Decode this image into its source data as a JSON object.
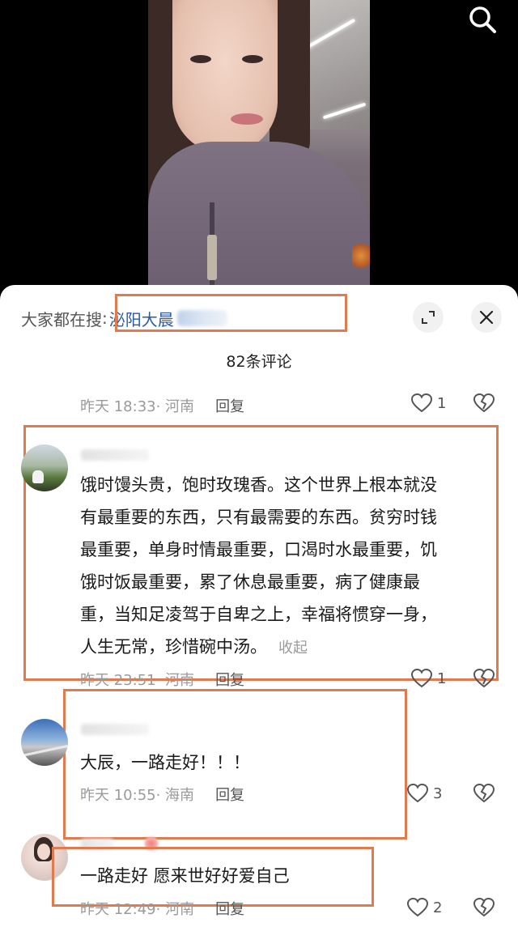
{
  "video": {
    "has_search": true
  },
  "header": {
    "trending_label": "大家都在搜",
    "trending_colon": ":",
    "trending_term": "泌阳大晨",
    "comment_count_title": "82条评论"
  },
  "comments": [
    {
      "time": "昨天 18:33",
      "location": "· 河南",
      "reply_label": "回复",
      "likes": "1"
    },
    {
      "lines": [
        "饿时馒头贵，饱时玫瑰香。这个世界上根本就没",
        "有最重要的东西，只有最需要的东西。贫穷时钱",
        "最重要，单身时情最重要，口渴时水最重要，饥",
        "饿时饭最重要，累了休息最重要，病了健康最",
        "重，当知足凌驾于自卑之上，幸福将惯穿一身，",
        "人生无常，珍惜碗中汤。"
      ],
      "collapse_label": "收起",
      "time": "昨天 23:51",
      "location": "· 河南",
      "reply_label": "回复",
      "likes": "1"
    },
    {
      "text": "大辰，一路走好！！！",
      "time": "昨天 10:55",
      "location": "· 海南",
      "reply_label": "回复",
      "likes": "3"
    },
    {
      "text": "一路走好 愿来世好好爱自己",
      "time": "昨天 12:49",
      "location": "· 河南",
      "reply_label": "回复",
      "likes": "2"
    }
  ],
  "colors": {
    "highlight_box": "#e07b4f",
    "trending_term": "#2a5aa6",
    "meta_gray": "#9a9a9a"
  },
  "icons": {
    "search": "search-icon",
    "expand": "expand-icon",
    "close": "close-icon",
    "like": "heart-icon",
    "dislike": "broken-heart-icon"
  }
}
